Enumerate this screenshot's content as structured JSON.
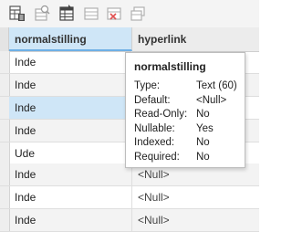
{
  "toolbar": {
    "icons": [
      "field-table-icon",
      "calculate-field-icon",
      "data-table-icon",
      "table-view-icon",
      "delete-table-icon",
      "copy-table-icon"
    ]
  },
  "grid": {
    "columns": [
      "normalstilling",
      "hyperlink"
    ],
    "rows": [
      {
        "c1": "Inde",
        "c2": ""
      },
      {
        "c1": "Inde",
        "c2": ""
      },
      {
        "c1": "Inde",
        "c2": ""
      },
      {
        "c1": "Inde",
        "c2": ""
      },
      {
        "c1": "Ude",
        "c2": ""
      },
      {
        "c1": "Inde",
        "c2": "<Null>"
      },
      {
        "c1": "Inde",
        "c2": "<Null>"
      },
      {
        "c1": "Inde",
        "c2": "<Null>"
      }
    ]
  },
  "tooltip": {
    "title": "normalstilling",
    "lines": [
      {
        "key": "Type:",
        "value": "Text (60)"
      },
      {
        "key": "Default:",
        "value": "<Null>"
      },
      {
        "key": "Read-Only:",
        "value": "No"
      },
      {
        "key": "Nullable:",
        "value": "Yes"
      },
      {
        "key": "Indexed:",
        "value": "No"
      },
      {
        "key": "Required:",
        "value": "No"
      }
    ]
  },
  "colors": {
    "selected_cell": "#cfe6f7",
    "header_accent": "#6eb0e6",
    "alt_row": "#f3f3f3"
  }
}
